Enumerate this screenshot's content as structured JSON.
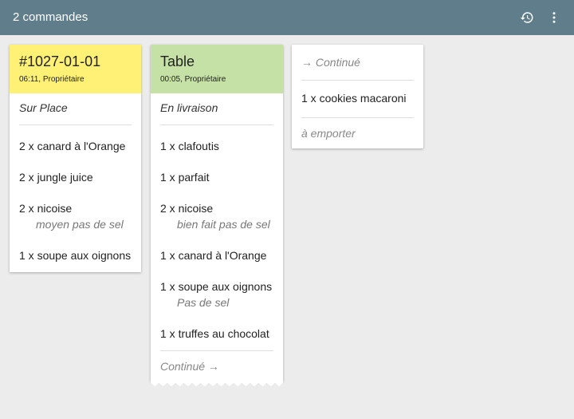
{
  "appbar": {
    "title": "2 commandes",
    "history_icon": "history-icon",
    "menu_icon": "more-vert-icon",
    "background": "#607d8b"
  },
  "cards": [
    {
      "title": "#1027-01-01",
      "subtitle": "06:11, Propriétaire",
      "header_color": "#fff176",
      "type": "Sur Place",
      "items": [
        {
          "text": "2 x canard à l'Orange",
          "note": ""
        },
        {
          "text": "2 x jungle juice",
          "note": ""
        },
        {
          "text": "2 x nicoise",
          "note": "moyen pas de sel"
        },
        {
          "text": "1 x soupe aux oignons",
          "note": ""
        }
      ]
    },
    {
      "title": "Table",
      "subtitle": "00:05, Propriétaire",
      "header_color": "#c5e1a5",
      "type": "En livraison",
      "items": [
        {
          "text": "1 x clafoutis",
          "note": ""
        },
        {
          "text": "1 x parfait",
          "note": ""
        },
        {
          "text": "2 x nicoise",
          "note": "bien fait pas de sel"
        },
        {
          "text": "1 x canard à l'Orange",
          "note": ""
        },
        {
          "text": "1 x soupe aux oignons",
          "note": "Pas de sel"
        },
        {
          "text": "1 x truffes au chocolat",
          "note": ""
        }
      ],
      "footer": "Continué →"
    },
    {
      "continued_header": "→ Continué",
      "items": [
        {
          "text": "1 x cookies macaroni",
          "note": ""
        }
      ],
      "footer": "à emporter"
    }
  ]
}
